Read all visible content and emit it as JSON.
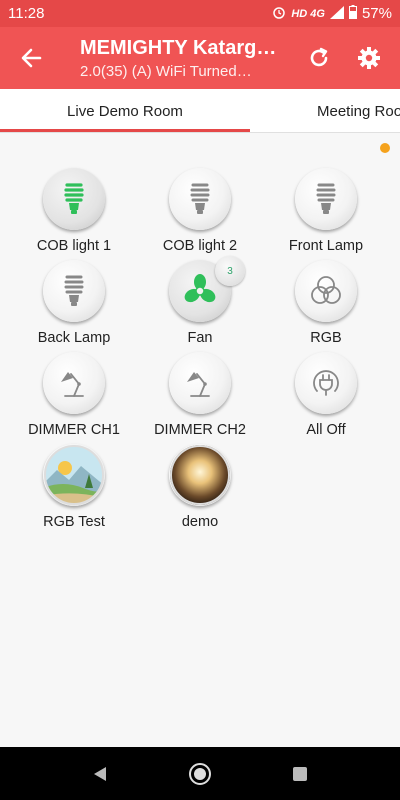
{
  "status_bar": {
    "time": "11:28",
    "network": "HD 4G",
    "battery": "57%"
  },
  "app_bar": {
    "title": "MEMIGHTY Katarg…",
    "subtitle": "2.0(35) (A) WiFi Turned…",
    "icons": [
      "back-arrow-icon",
      "refresh-icon",
      "gear-icon"
    ]
  },
  "tabs": [
    {
      "label": "Live Demo Room",
      "selected": true
    },
    {
      "label": "Meeting Roo",
      "selected": false
    }
  ],
  "colors": {
    "app_bar": "#f05454",
    "status_bar": "#e54848",
    "indicator_dot": "#f5a21c",
    "active_green": "#2fbf5a"
  },
  "devices": [
    {
      "label": "COB light 1",
      "icon": "bulb-icon",
      "on": true
    },
    {
      "label": "COB light 2",
      "icon": "bulb-icon",
      "on": false
    },
    {
      "label": "Front Lamp",
      "icon": "bulb-icon",
      "on": false
    },
    {
      "label": "Back Lamp",
      "icon": "bulb-icon",
      "on": false
    },
    {
      "label": "Fan",
      "icon": "fan-icon",
      "on": true,
      "speed": "3"
    },
    {
      "label": "RGB",
      "icon": "rgb-icon",
      "on": false
    },
    {
      "label": "DIMMER CH1",
      "icon": "desk-lamp-icon",
      "on": false
    },
    {
      "label": "DIMMER CH2",
      "icon": "desk-lamp-icon",
      "on": false
    },
    {
      "label": "All Off",
      "icon": "plug-icon",
      "on": false
    },
    {
      "label": "RGB Test",
      "icon": "landscape-icon",
      "on": false
    },
    {
      "label": "demo",
      "icon": "glowing-orb-icon",
      "on": false
    }
  ]
}
